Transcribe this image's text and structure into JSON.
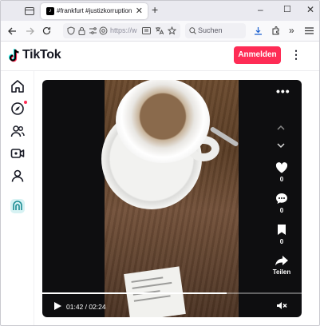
{
  "browser": {
    "tab_title": "#frankfurt #justizkorruption | Ti",
    "url_text": "https://w",
    "search_placeholder": "Suchen",
    "newtab": "+",
    "tab_close": "✕",
    "win_min": "–",
    "win_max": "☐",
    "win_close": "✕",
    "icons": [
      "tab-overview-icon",
      "back-icon",
      "forward-icon",
      "reload-icon",
      "shield-icon",
      "lock-icon",
      "permissions-icon",
      "reader-icon",
      "translate-icon",
      "bookmark-star-icon",
      "download-icon",
      "extensions-icon",
      "overflow-icon",
      "menu-icon"
    ]
  },
  "tiktok": {
    "brand": "TikTok",
    "login_label": "Anmelden",
    "sidebar": [
      "home-icon",
      "explore-icon",
      "following-icon",
      "live-icon",
      "profile-icon",
      "app-icon"
    ],
    "accent_color": "#fe2c55"
  },
  "video": {
    "like_count": "0",
    "comment_count": "0",
    "save_count": "0",
    "share_label": "Teilen",
    "current_time": "01:42",
    "duration": "02:24",
    "time_display": "01:42 / 02:24",
    "progress": 0.71
  }
}
